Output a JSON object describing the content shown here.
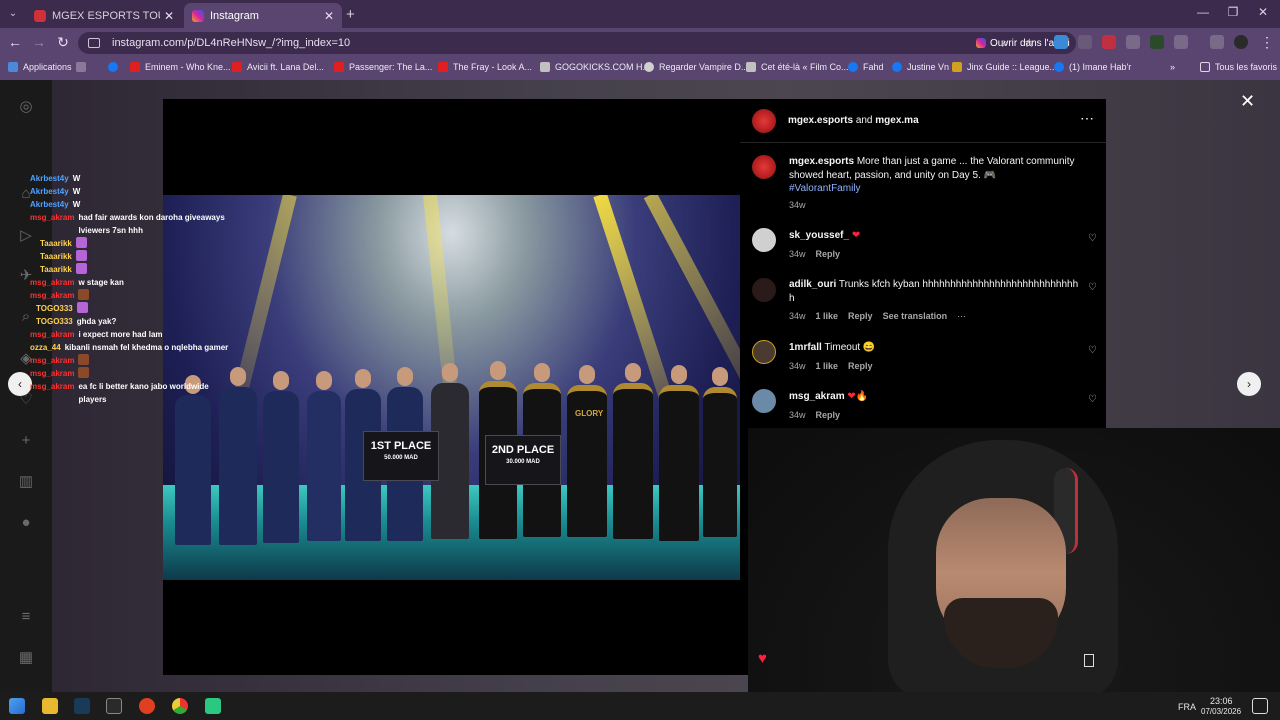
{
  "browser": {
    "tabs": [
      {
        "title": "MGEX ESPORTS TOURNAMENT",
        "active": false
      },
      {
        "title": "Instagram",
        "active": true
      }
    ],
    "url": "instagram.com/p/DL4nReHNsw_/?img_index=10",
    "open_app_label": "Ouvrir dans l'appli",
    "bookmarks": [
      "Applications",
      "Eminem - Who Kne...",
      "Avicii ft. Lana Del...",
      "Passenger: The La...",
      "The Fray - Look A...",
      "GOGOKICKS.COM H...",
      "Regarder Vampire D...",
      "Cet été-là « Film Co...",
      "Fahd",
      "Justine Vn",
      "Jinx Guide :: League...",
      "(1) Imane Hab'r"
    ],
    "all_bookmarks": "Tous les favoris"
  },
  "chat": [
    {
      "user": "Akrbest4y",
      "color": "blue",
      "msg": "W"
    },
    {
      "user": "Akrbest4y",
      "color": "blue",
      "msg": "W"
    },
    {
      "user": "Akrbest4y",
      "color": "blue",
      "msg": "W"
    },
    {
      "user": "msg_akram",
      "color": "red",
      "msg": "had fair awards kon daroha giveaways lviewers 7sn hhh"
    },
    {
      "user": "Taaarikk",
      "color": "yellow",
      "emote": "purple"
    },
    {
      "user": "Taaarikk",
      "color": "yellow",
      "emote": "purple"
    },
    {
      "user": "Taaarikk",
      "color": "yellow",
      "emote": "purple"
    },
    {
      "user": "msg_akram",
      "color": "red",
      "msg": "w stage kan"
    },
    {
      "user": "msg_akram",
      "color": "red",
      "emote": "brown"
    },
    {
      "user": "TOGO333",
      "color": "yellow",
      "emote": "purple"
    },
    {
      "user": "TOGO333",
      "color": "yellow",
      "msg": "ghda yak?"
    },
    {
      "user": "msg_akram",
      "color": "red",
      "msg": "i expect more had lam"
    },
    {
      "user": "ozza_44",
      "color": "yellow",
      "msg": "kibanli nsmah fel khedma o nqlebha gamer"
    },
    {
      "user": "msg_akram",
      "color": "red",
      "emote": "brown"
    },
    {
      "user": "msg_akram",
      "color": "red",
      "emote": "brown"
    },
    {
      "user": "msg_akram",
      "color": "red",
      "msg": "ea fc li better kano jabo worldwide players"
    }
  ],
  "post": {
    "header_account_1": "mgex.esports",
    "header_and": "and",
    "header_account_2": "mgex.ma",
    "caption_user": "mgex.esports",
    "caption_text": "More than just a game ... the Valorant community showed heart, passion, and unity on Day 5. 🎮",
    "caption_hashtag": "#ValorantFamily",
    "caption_age": "34w",
    "banner_1_place": "1ST PLACE",
    "banner_1_amount": "50.000 MAD",
    "banner_2_place": "2ND PLACE",
    "banner_2_amount": "30.000 MAD",
    "team_shirt": "GLORY",
    "comments": [
      {
        "user": "sk_youssef_",
        "text": "❤",
        "age": "34w",
        "likes": "",
        "reply": "Reply",
        "translate": "",
        "avatar": "grey"
      },
      {
        "user": "adilk_ouri",
        "text": "Trunks kfch kyban hhhhhhhhhhhhhhhhhhhhhhhhhhhhh",
        "age": "34w",
        "likes": "1 like",
        "reply": "Reply",
        "translate": "See translation",
        "avatar": "dark"
      },
      {
        "user": "1mrfall",
        "text": "Timeout 😄",
        "age": "34w",
        "likes": "1 like",
        "reply": "Reply",
        "translate": "",
        "avatar": "face"
      },
      {
        "user": "msg_akram",
        "text": "❤🔥",
        "age": "34w",
        "likes": "",
        "reply": "Reply",
        "translate": "",
        "avatar": "blue"
      }
    ]
  },
  "taskbar": {
    "lang": "FRA",
    "time": "23:06",
    "date": "07/03/2026"
  }
}
